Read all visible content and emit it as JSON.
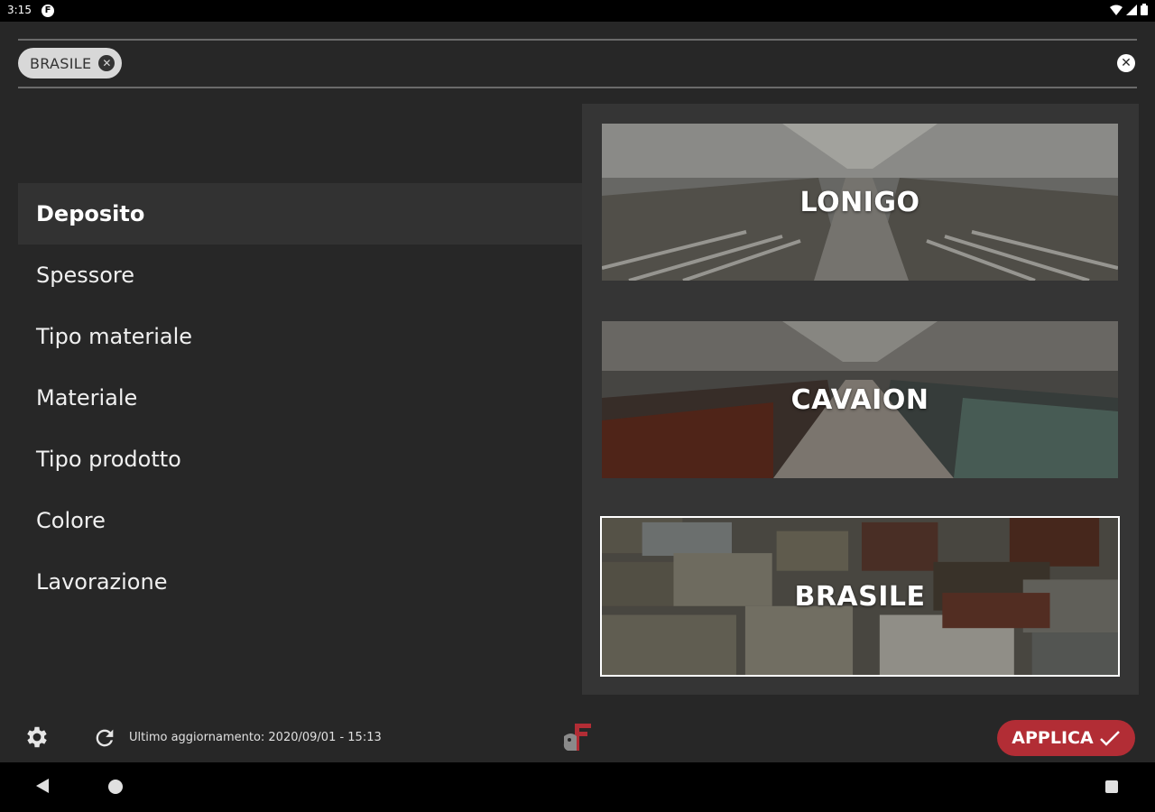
{
  "status_bar": {
    "time": "3:15",
    "app_icon_letter": "F"
  },
  "search": {
    "chip_label": "BRASILE",
    "chip_close_glyph": "✕",
    "clear_glyph": "✕"
  },
  "filters": {
    "items": [
      {
        "label": "Deposito",
        "active": true
      },
      {
        "label": "Spessore"
      },
      {
        "label": "Tipo materiale"
      },
      {
        "label": "Materiale"
      },
      {
        "label": "Tipo prodotto"
      },
      {
        "label": "Colore"
      },
      {
        "label": "Lavorazione"
      }
    ]
  },
  "options": {
    "items": [
      {
        "label": "LONIGO",
        "selected": false
      },
      {
        "label": "CAVAION",
        "selected": false
      },
      {
        "label": "BRASILE",
        "selected": true
      }
    ]
  },
  "footer": {
    "last_update": "Ultimo aggiornamento: 2020/09/01 - 15:13",
    "apply_label": "APPLICA",
    "apply_color": "#b22d35"
  },
  "colors": {
    "background": "#272727",
    "panel": "#353535",
    "active_item": "#323232"
  }
}
